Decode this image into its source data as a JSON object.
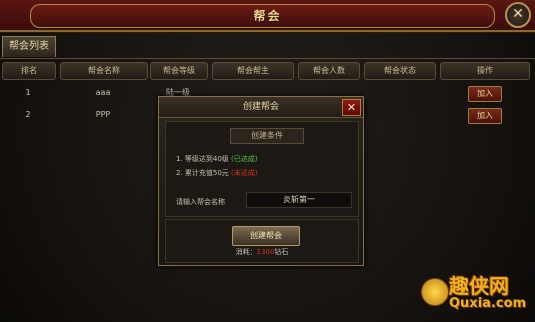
{
  "window": {
    "title": "帮会"
  },
  "tabs": [
    {
      "label": "帮会列表"
    }
  ],
  "table": {
    "headers": [
      "排名",
      "帮会名称",
      "帮会等级",
      "帮会帮主",
      "帮会人数",
      "帮会状态",
      "操作"
    ],
    "rows": [
      {
        "rank": "1",
        "name": "aaa",
        "level": "陆一级",
        "leader": "",
        "members": "",
        "status": "",
        "action": "加入"
      },
      {
        "rank": "2",
        "name": "PPP",
        "level": "",
        "leader": "",
        "members": "",
        "status": "",
        "action": "加入"
      }
    ]
  },
  "dialog": {
    "title": "创建帮会",
    "conditions_label": "创建条件",
    "req1_text": "1. 等级达到40级",
    "req1_status": "(已达成)",
    "req2_text": "2. 累计充值50元",
    "req2_status": "(未达成)",
    "name_label": "请输入帮会名称",
    "name_value": "炎斩第一",
    "create_button": "创建帮会",
    "cost_label": "消耗：",
    "cost_amount": "1300",
    "cost_unit": "钻石"
  },
  "watermark": {
    "line1": "趣侠网",
    "line2": "Quxia.com"
  },
  "colors": {
    "ok": "#4ccf3a",
    "fail": "#e03020",
    "gold": "#f0b020"
  }
}
